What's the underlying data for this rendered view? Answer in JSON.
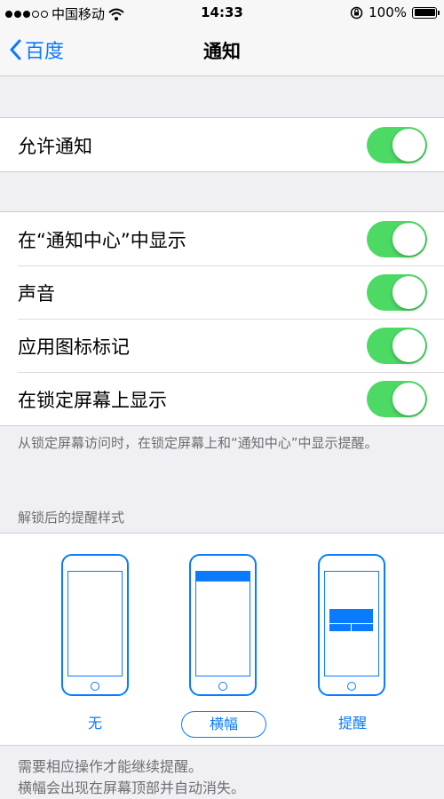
{
  "status_bar": {
    "carrier": "中国移动",
    "time": "14:33",
    "battery_percent": "100%"
  },
  "nav": {
    "back_label": "百度",
    "title": "通知"
  },
  "allow_group": {
    "items": [
      {
        "label": "允许通知",
        "on": true
      }
    ]
  },
  "options_group": {
    "items": [
      {
        "label": "在“通知中心”中显示",
        "on": true
      },
      {
        "label": "声音",
        "on": true
      },
      {
        "label": "应用图标标记",
        "on": true
      },
      {
        "label": "在锁定屏幕上显示",
        "on": true
      }
    ],
    "footer": "从锁定屏幕访问时，在锁定屏幕上和“通知中心”中显示提醒。"
  },
  "alert_style": {
    "header": "解锁后的提醒样式",
    "options": [
      {
        "label": "无",
        "selected": false
      },
      {
        "label": "横幅",
        "selected": true
      },
      {
        "label": "提醒",
        "selected": false
      }
    ],
    "note_line1": "需要相应操作才能继续提醒。",
    "note_line2": "横幅会出现在屏幕顶部并自动消失。"
  },
  "colors": {
    "accent": "#0a7aff",
    "toggle_on": "#4cd964",
    "background": "#efeff4"
  }
}
